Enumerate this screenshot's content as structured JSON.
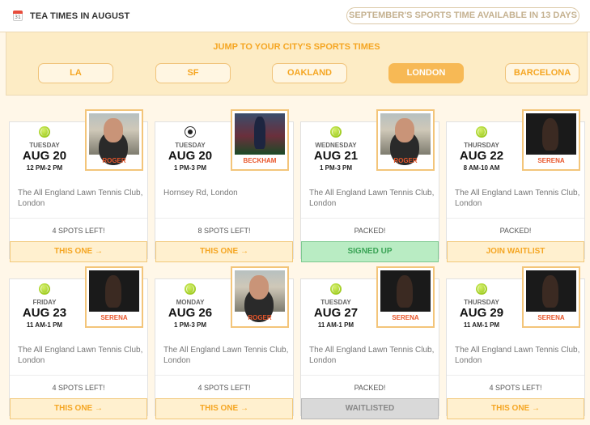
{
  "header": {
    "title": "TEA TIMES IN AUGUST",
    "calendar_day": "31",
    "next_month_label": "SEPTEMBER'S SPORTS TIME AVAILABLE IN 13 DAYS"
  },
  "city_picker": {
    "heading": "JUMP TO YOUR CITY'S SPORTS TIMES",
    "cities": [
      "LA",
      "SF",
      "OAKLAND",
      "LONDON",
      "BARCELONA"
    ],
    "active": "LONDON"
  },
  "events": [
    {
      "sport": "tennis",
      "day": "TUESDAY",
      "date": "AUG 20",
      "time": "12 PM-2 PM",
      "player": "ROGER",
      "venue": "The All England Lawn Tennis Club, London",
      "spots": "4 SPOTS LEFT!",
      "action": "THIS ONE →",
      "action_state": "default"
    },
    {
      "sport": "soccer",
      "day": "TUESDAY",
      "date": "AUG 20",
      "time": "1 PM-3 PM",
      "player": "BECKHAM",
      "venue": "Hornsey Rd, London",
      "spots": "8 SPOTS LEFT!",
      "action": "THIS ONE →",
      "action_state": "default"
    },
    {
      "sport": "tennis",
      "day": "WEDNESDAY",
      "date": "AUG 21",
      "time": "1 PM-3 PM",
      "player": "ROGER",
      "venue": "The All England Lawn Tennis Club, London",
      "spots": "PACKED!",
      "action": "SIGNED UP",
      "action_state": "signed"
    },
    {
      "sport": "tennis",
      "day": "THURSDAY",
      "date": "AUG 22",
      "time": "8 AM-10 AM",
      "player": "SERENA",
      "venue": "The All England Lawn Tennis Club, London",
      "spots": "PACKED!",
      "action": "JOIN WAITLIST",
      "action_state": "default"
    },
    {
      "sport": "tennis",
      "day": "FRIDAY",
      "date": "AUG 23",
      "time": "11 AM-1 PM",
      "player": "SERENA",
      "venue": "The All England Lawn Tennis Club, London",
      "spots": "4 SPOTS LEFT!",
      "action": "THIS ONE →",
      "action_state": "default"
    },
    {
      "sport": "tennis",
      "day": "MONDAY",
      "date": "AUG 26",
      "time": "1 PM-3 PM",
      "player": "ROGER",
      "venue": "The All England Lawn Tennis Club, London",
      "spots": "4 SPOTS LEFT!",
      "action": "THIS ONE →",
      "action_state": "default"
    },
    {
      "sport": "tennis",
      "day": "TUESDAY",
      "date": "AUG 27",
      "time": "11 AM-1 PM",
      "player": "SERENA",
      "venue": "The All England Lawn Tennis Club, London",
      "spots": "PACKED!",
      "action": "WAITLISTED",
      "action_state": "waitlisted"
    },
    {
      "sport": "tennis",
      "day": "THURSDAY",
      "date": "AUG 29",
      "time": "11 AM-1 PM",
      "player": "SERENA",
      "venue": "The All England Lawn Tennis Club, London",
      "spots": "4 SPOTS LEFT!",
      "action": "THIS ONE →",
      "action_state": "default"
    }
  ],
  "colors": {
    "accent": "#f5a623",
    "panel": "#fdecc5",
    "signed": "#b9ecc3",
    "waitlisted": "#d9d9d9",
    "player_name": "#e8562b"
  }
}
